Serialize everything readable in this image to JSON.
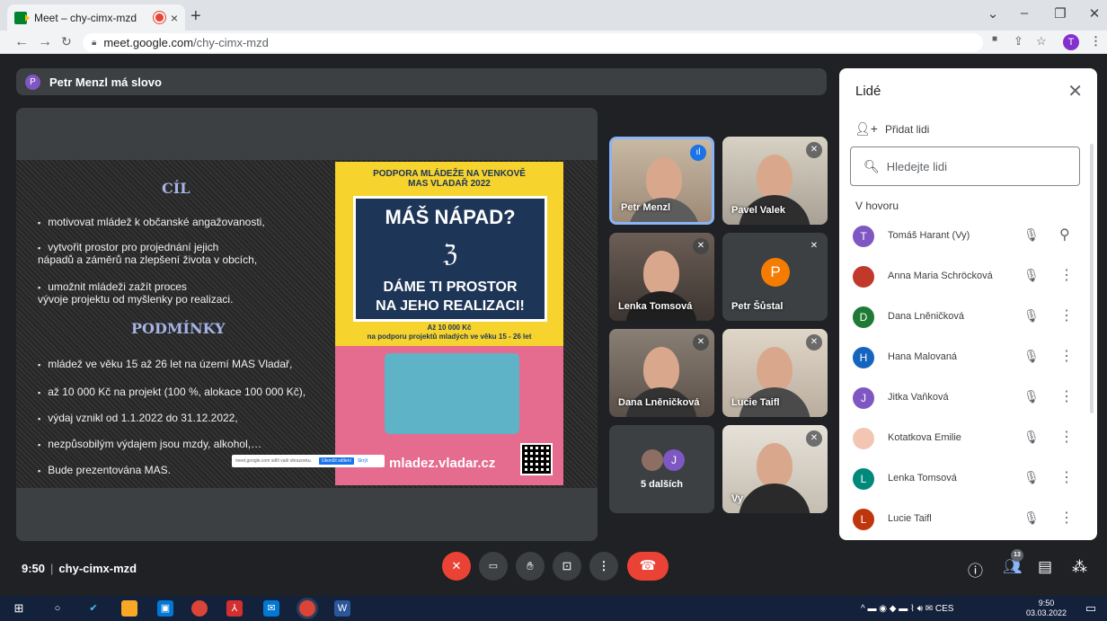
{
  "browser": {
    "tab_title": "Meet – chy-cimx-mzd",
    "tab_close": "×",
    "new_tab": "+",
    "url_domain": "meet.google.com",
    "url_path": "/chy-cimx-mzd",
    "profile_initial": "T",
    "win_min": "–",
    "win_max": "❐",
    "win_close": "✕",
    "win_chevron": "⌄"
  },
  "speaker": {
    "initial": "P",
    "text": "Petr Menzl má slovo"
  },
  "slide": {
    "heading1": "CÍL",
    "goals": [
      "motivovat mládež k občanské angažovanosti,",
      "vytvořit prostor pro projednání jejich",
      "nápadů a záměrů na zlepšení života v obcích,",
      "umožnit mládeži zažít proces",
      "vývoje projektu od myšlenky po realizaci."
    ],
    "heading2": "PODMÍNKY",
    "conditions": [
      "mládež ve věku 15 až 26 let na území MAS Vladař,",
      "až 10 000 Kč na projekt (100 %, alokace 100 000 Kč),",
      "výdaj vznikl od 1.1.2022 do 31.12.2022,",
      "nezpůsobilým výdajem jsou mzdy, alkohol,…",
      "Bude prezentována MAS."
    ]
  },
  "poster": {
    "top1": "PODPORA MLÁDEŽE NA VENKOVĚ",
    "top2": "MAS VLADAŘ 2022",
    "big1": "MÁŠ NÁPAD?",
    "scribble": "ℨ",
    "big2a": "DÁME TI PROSTOR",
    "big2b": "NA JEHO REALIZACI!",
    "amount1": "Až 10 000 Kč",
    "amount2": "na podporu projektů mladých ve věku 15 - 26 let",
    "url": "mladez.vladar.cz"
  },
  "sharebar": {
    "text": "meet.google.com sdílí vaši obrazovku.",
    "stop": "Ukončit sdílení",
    "hide": "Skrýt"
  },
  "tiles": [
    {
      "name": "Petr Menzl"
    },
    {
      "name": "Pavel Valek"
    },
    {
      "name": "Lenka Tomsová"
    },
    {
      "name": "Petr Šůstal",
      "initial": "P"
    },
    {
      "name": "Dana Lněničková"
    },
    {
      "name": "Lucie Taifl"
    },
    {
      "name": "5 dalších",
      "initial": "J"
    },
    {
      "name": "Vy"
    }
  ],
  "panel": {
    "title": "Lidé",
    "close": "✕",
    "add_label": "Přidat lidi",
    "search_placeholder": "Hledejte lidi",
    "section": "V hovoru",
    "people": [
      {
        "initial": "T",
        "name": "Tomáš Harant (Vy)",
        "color": "#7e57c2"
      },
      {
        "initial": "",
        "name": "Anna Maria Schröcková",
        "color": "#c0392b"
      },
      {
        "initial": "D",
        "name": "Dana Lněničková",
        "color": "#1e7a34"
      },
      {
        "initial": "H",
        "name": "Hana Malovaná",
        "color": "#1565c0"
      },
      {
        "initial": "J",
        "name": "Jitka Vaňková",
        "color": "#7e57c2"
      },
      {
        "initial": "",
        "name": "Kotatkova Emilie",
        "color": "#f3c6b4"
      },
      {
        "initial": "L",
        "name": "Lenka Tomsová",
        "color": "#00897b"
      },
      {
        "initial": "L",
        "name": "Lucie Taifl",
        "color": "#bf360c"
      }
    ]
  },
  "bottom": {
    "time": "9:50",
    "separator": "|",
    "code": "chy-cimx-mzd",
    "participants": "13"
  },
  "taskbar": {
    "lang": "CES",
    "time": "9:50",
    "date": "03.03.2022"
  }
}
